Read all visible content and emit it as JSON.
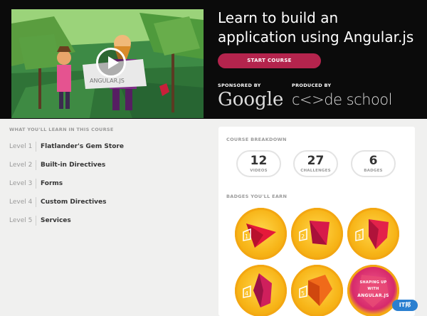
{
  "hero": {
    "title": "Learn to build an application using Angular.js",
    "start_label": "START COURSE",
    "sponsored_label": "SPONSORED BY",
    "produced_label": "PRODUCED BY",
    "sponsor_name": "Google",
    "producer_name": "c<>de school",
    "video_sign_text": "ANGULAR.JS"
  },
  "learn": {
    "heading": "WHAT YOU'LL LEARN IN THIS COURSE",
    "levels": [
      {
        "num": "Level 1",
        "name": "Flatlander's Gem Store"
      },
      {
        "num": "Level 2",
        "name": "Built-in Directives"
      },
      {
        "num": "Level 3",
        "name": "Forms"
      },
      {
        "num": "Level 4",
        "name": "Custom Directives"
      },
      {
        "num": "Level 5",
        "name": "Services"
      }
    ]
  },
  "breakdown": {
    "heading": "COURSE BREAKDOWN",
    "stats": [
      {
        "value": "12",
        "label": "VIDEOS"
      },
      {
        "value": "27",
        "label": "CHALLENGES"
      },
      {
        "value": "6",
        "label": "BADGES"
      }
    ]
  },
  "badges": {
    "heading": "BADGES YOU'LL EARN",
    "items": [
      "1",
      "2",
      "3",
      "4",
      "5",
      "6"
    ],
    "final_badge_text_top": "SHAPING UP",
    "final_badge_text_mid": "WITH",
    "final_badge_text_bottom": "ANGULAR.JS"
  },
  "colors": {
    "accent": "#b4244d",
    "badge_gold": "#f7b417",
    "gem_red": "#e5193a"
  },
  "watermark": {
    "text": "IT邦"
  }
}
